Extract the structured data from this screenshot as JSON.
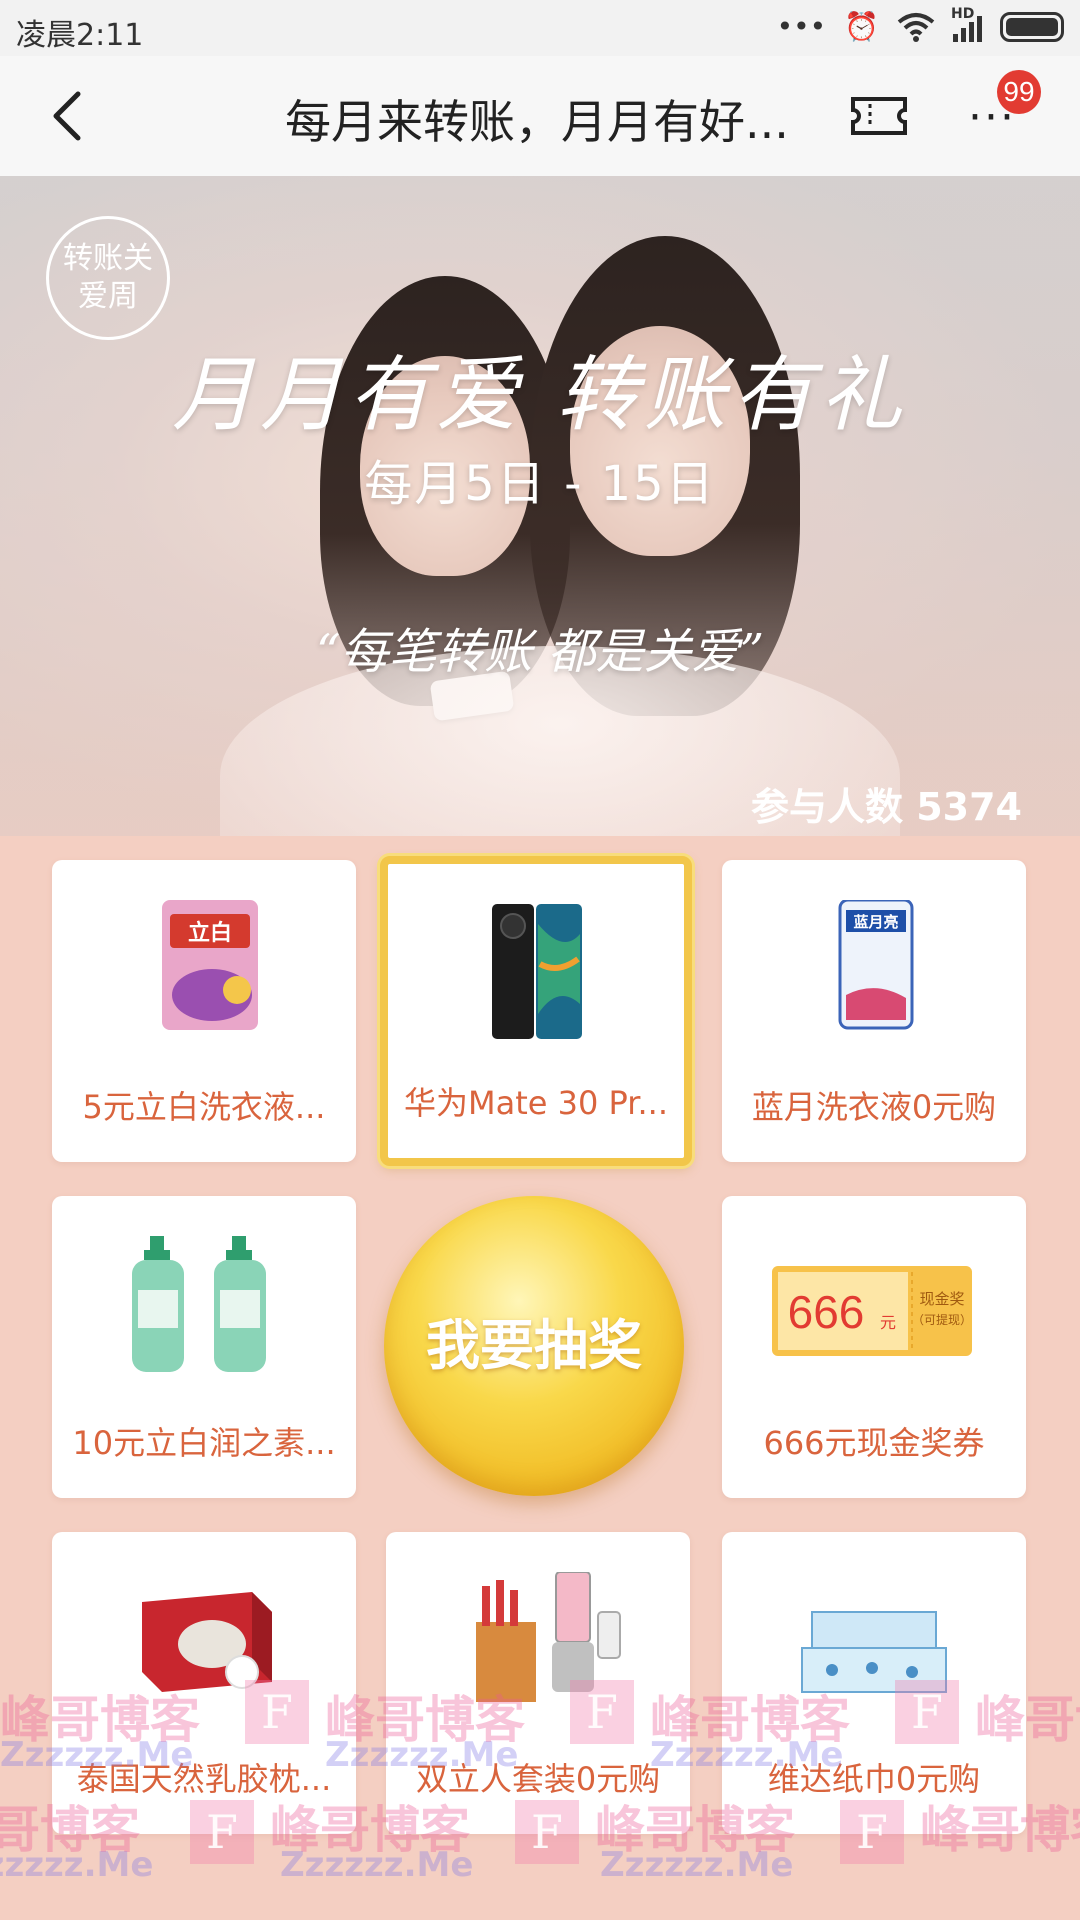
{
  "status_bar": {
    "time": "凌晨2:11",
    "icons": [
      "more-dots-icon",
      "alarm-icon",
      "wifi-icon",
      "hd-signal-icon",
      "battery-icon"
    ],
    "signal_label": "HD"
  },
  "nav": {
    "title": "每月来转账，月月有好...",
    "badge_count": "99",
    "back_icon": "back-chevron-icon",
    "ticket_icon": "ticket-icon",
    "more_icon": "more-icon"
  },
  "hero": {
    "logo_text": "转账关爱周",
    "title": "月月有爱  转账有礼",
    "subtitle": "每月5日 - 15日",
    "quote": "“每笔转账  都是关爱”",
    "participants": "参与人数 5374"
  },
  "prizes": [
    {
      "label": "5元立白洗衣液...",
      "image": "liby-detergent-bag",
      "selected": false
    },
    {
      "label": "华为Mate 30 Pr...",
      "image": "huawei-phone",
      "selected": true
    },
    {
      "label": "蓝月洗衣液0元购",
      "image": "bluemoon-detergent-bag",
      "selected": false
    },
    {
      "label": "10元立白润之素...",
      "image": "hand-soap-bottles",
      "selected": false
    },
    {
      "label": "666元现金奖券",
      "image": "cash-coupon",
      "selected": false
    },
    {
      "label": "泰国天然乳胶枕...",
      "image": "latex-pillow-box",
      "selected": false
    },
    {
      "label": "双立人套装0元购",
      "image": "knife-blender-set",
      "selected": false
    },
    {
      "label": "维达纸巾0元购",
      "image": "tissue-boxes",
      "selected": false
    }
  ],
  "coupon": {
    "amount": "666",
    "unit": "元",
    "title": "现金奖",
    "note": "（可提现）"
  },
  "product_text": {
    "liby": "立白",
    "bluemoon": "蓝月亮"
  },
  "draw_button": "我要抽奖",
  "watermark": {
    "text": "峰哥博客",
    "domain": "Zzzzzz.Me",
    "letter": "F"
  },
  "colors": {
    "accent_orange": "#d9643d",
    "gold": "#f2c64a",
    "badge_red": "#e23b32"
  }
}
